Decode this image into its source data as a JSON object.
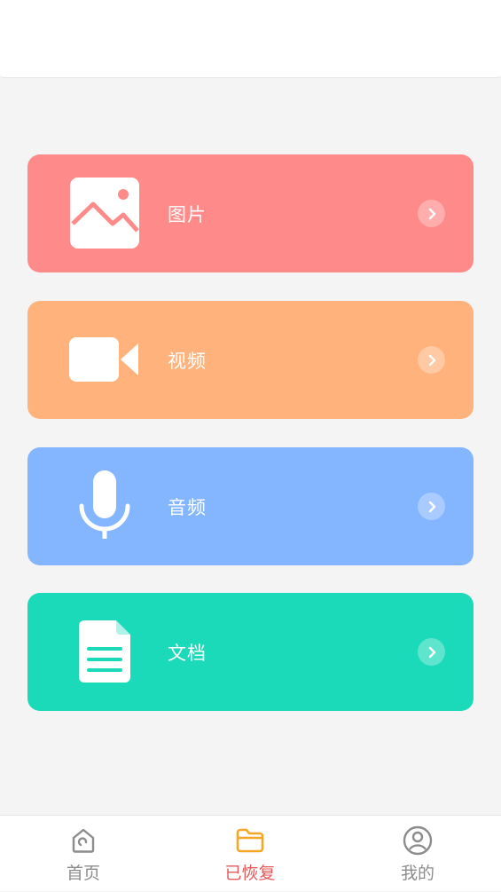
{
  "categories": [
    {
      "label": "图片",
      "color": "#ff8a8a",
      "icon": "image-icon"
    },
    {
      "label": "视频",
      "color": "#ffb27b",
      "icon": "video-camera-icon"
    },
    {
      "label": "音频",
      "color": "#84b5ff",
      "icon": "microphone-icon"
    },
    {
      "label": "文档",
      "color": "#1bdab9",
      "icon": "document-icon"
    }
  ],
  "nav": {
    "items": [
      {
        "label": "首页",
        "icon": "home-icon",
        "active": false
      },
      {
        "label": "已恢复",
        "icon": "folder-icon",
        "active": true
      },
      {
        "label": "我的",
        "icon": "user-icon",
        "active": false
      }
    ],
    "active_color": "#e65a5a",
    "active_icon_color": "#f5a623",
    "inactive_color": "#8c8c8c"
  }
}
